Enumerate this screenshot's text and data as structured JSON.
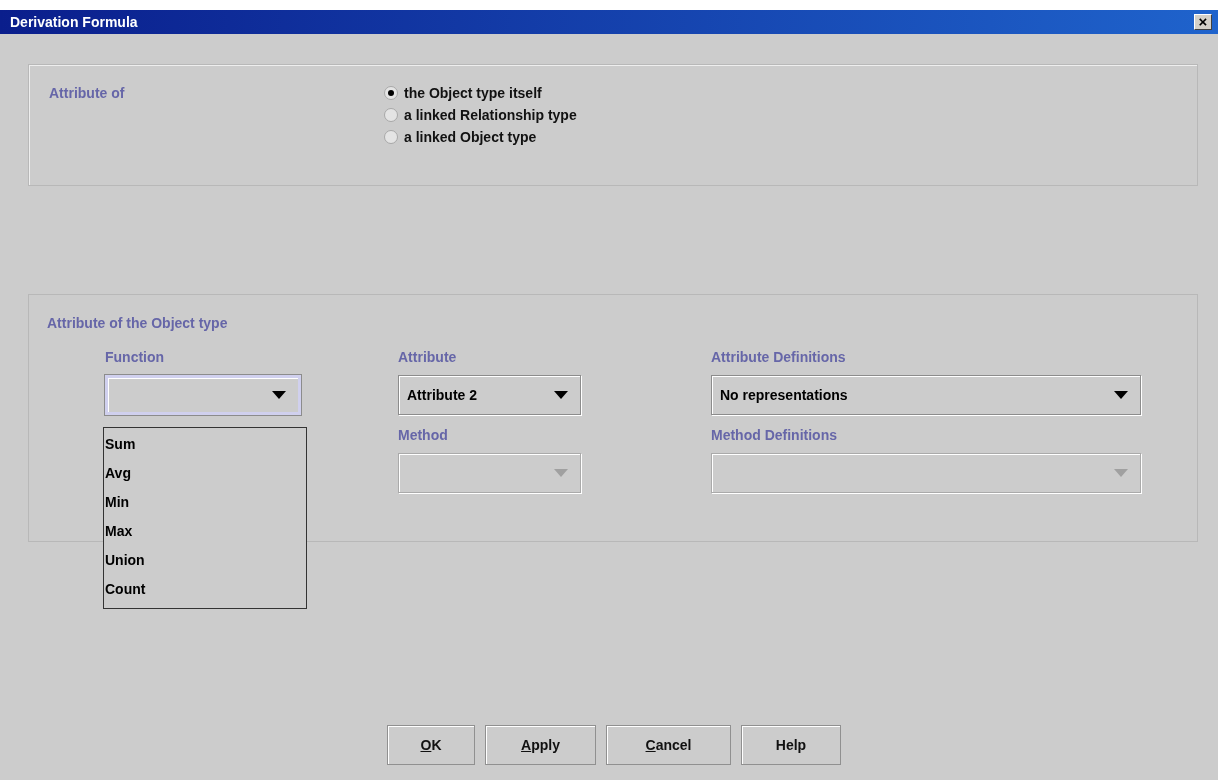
{
  "window": {
    "title": "Derivation Formula",
    "close": "×"
  },
  "attribute_of": {
    "label": "Attribute of",
    "options": [
      {
        "label": "the Object type itself",
        "selected": true
      },
      {
        "label": "a linked Relationship type",
        "selected": false
      },
      {
        "label": "a linked Object type",
        "selected": false
      }
    ]
  },
  "object_type_group": {
    "title": "Attribute of the Object type",
    "fields": [
      {
        "label": "Function",
        "disabled": false,
        "focused": true,
        "expanded": true,
        "options": [
          {
            "label": "Sum",
            "selected": false
          },
          {
            "label": "Avg",
            "selected": false
          },
          {
            "label": "Min",
            "selected": false
          },
          {
            "label": "Max",
            "selected": false
          },
          {
            "label": "Union",
            "selected": false
          },
          {
            "label": "Count",
            "selected": false
          }
        ]
      },
      {
        "label": "Attribute",
        "value": "Attribute 2",
        "disabled": false,
        "focused": false
      },
      {
        "label": "Attribute Definitions",
        "value": "No representations",
        "disabled": false,
        "focused": false
      },
      {
        "label": "Method",
        "disabled": true,
        "focused": false
      },
      {
        "label": "Method Definitions",
        "disabled": true,
        "focused": false
      }
    ]
  },
  "buttons": [
    {
      "mnemonic": "O",
      "rest": "K"
    },
    {
      "mnemonic": "A",
      "rest": "pply"
    },
    {
      "mnemonic": "C",
      "rest": "ancel"
    },
    {
      "rest": "Help"
    }
  ]
}
